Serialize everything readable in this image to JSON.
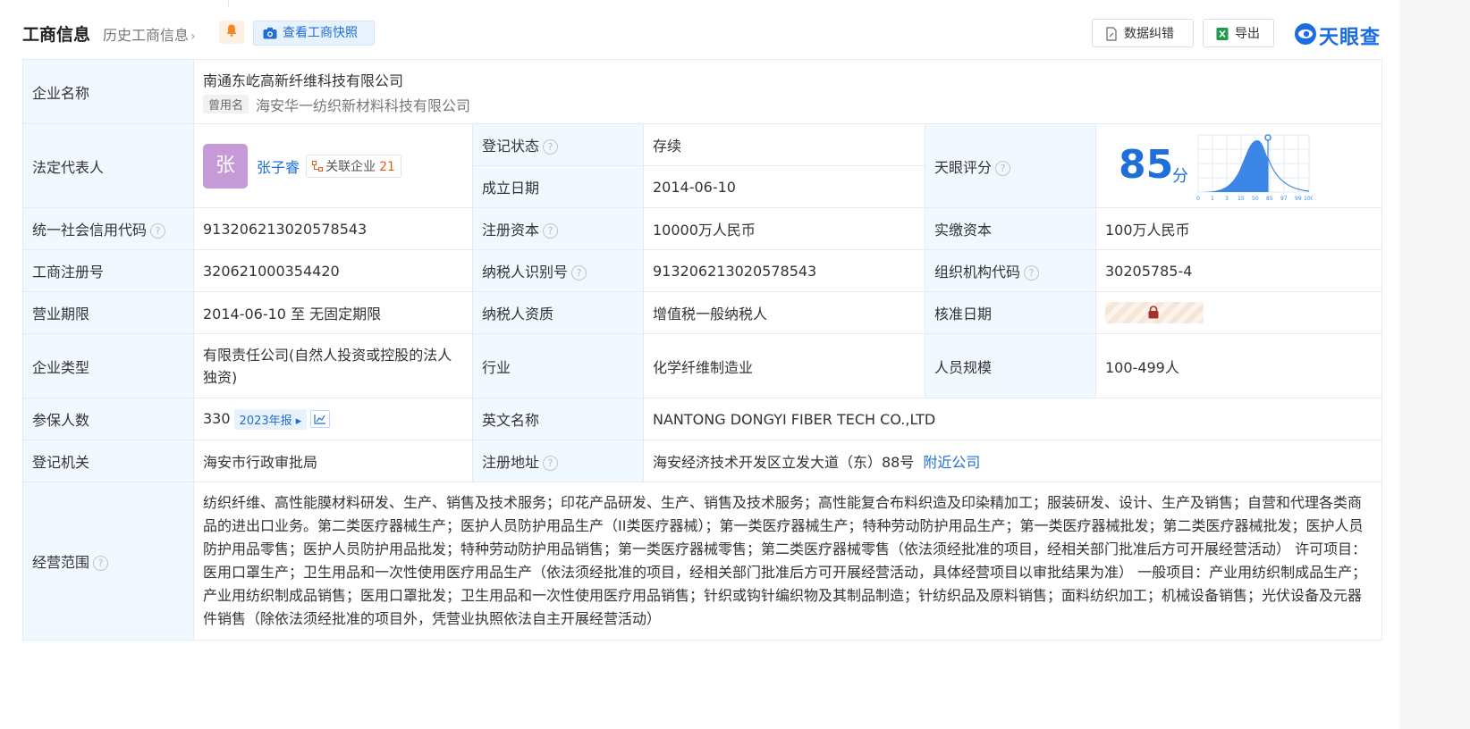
{
  "header": {
    "title": "工商信息",
    "history_link": "历史工商信息",
    "snapshot_button": "查看工商快照",
    "data_fix_button": "数据纠错",
    "export_button": "导出",
    "logo_text": "天眼查"
  },
  "colors": {
    "accent": "#1e6fd9",
    "key_cell_bg": "#f2f8ff",
    "status_green": "#21a241",
    "count_orange": "#e45d17",
    "avatar": "#c59ad6"
  },
  "company": {
    "name_label": "企业名称",
    "name": "南通东屹高新纤维科技有限公司",
    "used_name_tag": "曾用名",
    "used_name": "海安华一纺织新材料科技有限公司"
  },
  "rep": {
    "label": "法定代表人",
    "avatar_char": "张",
    "name": "张子睿",
    "related_label": "关联企业",
    "related_count": "21"
  },
  "status": {
    "label": "登记状态",
    "value": "存续"
  },
  "founded": {
    "label": "成立日期",
    "value": "2014-06-10"
  },
  "score": {
    "label": "天眼评分",
    "value": "85",
    "unit": "分",
    "axis_ticks": [
      "0",
      "1",
      "3",
      "15",
      "50",
      "85",
      "97",
      "99",
      "100"
    ]
  },
  "rows": {
    "credit_code": {
      "label": "统一社会信用代码",
      "value": "913206213020578543"
    },
    "reg_capital": {
      "label": "注册资本",
      "value": "10000万人民币"
    },
    "paid_capital": {
      "label": "实缴资本",
      "value": "100万人民币"
    },
    "reg_no": {
      "label": "工商注册号",
      "value": "320621000354420"
    },
    "taxpayer_id": {
      "label": "纳税人识别号",
      "value": "913206213020578543"
    },
    "org_code": {
      "label": "组织机构代码",
      "value": "30205785-4"
    },
    "term": {
      "label": "营业期限",
      "value": "2014-06-10 至 无固定期限"
    },
    "taxpayer_qual": {
      "label": "纳税人资质",
      "value": "增值税一般纳税人"
    },
    "approval_date": {
      "label": "核准日期"
    },
    "company_type": {
      "label": "企业类型",
      "value": "有限责任公司(自然人投资或控股的法人独资)"
    },
    "industry": {
      "label": "行业",
      "value": "化学纤维制造业"
    },
    "staff_size": {
      "label": "人员规模",
      "value": "100-499人"
    },
    "insured": {
      "label": "参保人数",
      "value": "330",
      "report_tag": "2023年报"
    },
    "english_name": {
      "label": "英文名称",
      "value": "NANTONG DONGYI FIBER TECH CO.,LTD"
    },
    "authority": {
      "label": "登记机关",
      "value": "海安市行政审批局"
    },
    "address": {
      "label": "注册地址",
      "value": "海安经济技术开发区立发大道（东）88号",
      "nearby_link": "附近公司"
    },
    "scope": {
      "label": "经营范围",
      "value": "纺织纤维、高性能膜材料研发、生产、销售及技术服务；印花产品研发、生产、销售及技术服务；高性能复合布料织造及印染精加工；服装研发、设计、生产及销售；自营和代理各类商品的进出口业务。第二类医疗器械生产；医护人员防护用品生产（II类医疗器械）；第一类医疗器械生产；特种劳动防护用品生产；第一类医疗器械批发；第二类医疗器械批发；医护人员防护用品零售；医护人员防护用品批发；特种劳动防护用品销售；第一类医疗器械零售；第二类医疗器械零售（依法须经批准的项目，经相关部门批准后方可开展经营活动） 许可项目：医用口罩生产；卫生用品和一次性使用医疗用品生产（依法须经批准的项目，经相关部门批准后方可开展经营活动，具体经营项目以审批结果为准） 一般项目：产业用纺织制成品生产；产业用纺织制成品销售；医用口罩批发；卫生用品和一次性使用医疗用品销售；针织或钩针编织物及其制品制造；针纺织品及原料销售；面料纺织加工；机械设备销售；光伏设备及元器件销售（除依法须经批准的项目外，凭营业执照依法自主开展经营活动）"
    }
  }
}
